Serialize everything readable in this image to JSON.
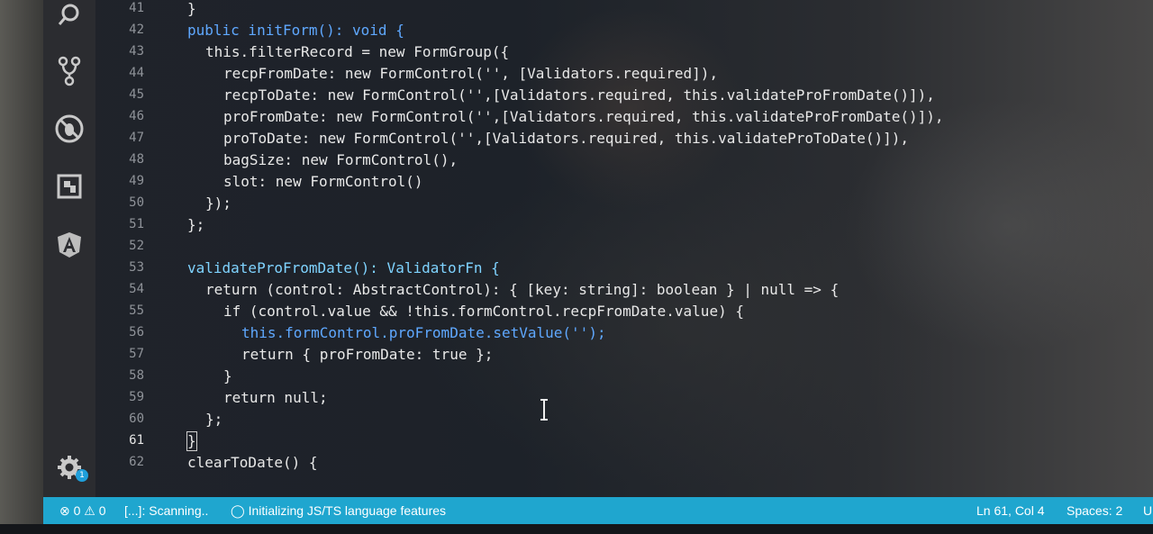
{
  "editor": {
    "lines": [
      {
        "n": "41",
        "text": "}"
      },
      {
        "n": "42",
        "text": "public initForm(): void {"
      },
      {
        "n": "43",
        "text": "this.filterRecord = new FormGroup({"
      },
      {
        "n": "44",
        "text": "recpFromDate: new FormControl('', [Validators.required]),"
      },
      {
        "n": "45",
        "text": "recpToDate: new FormControl('',[Validators.required, this.validateProFromDate()]),"
      },
      {
        "n": "46",
        "text": "proFromDate: new FormControl('',[Validators.required, this.validateProFromDate()]),"
      },
      {
        "n": "47",
        "text": "proToDate: new FormControl('',[Validators.required, this.validateProToDate()]),"
      },
      {
        "n": "48",
        "text": "bagSize: new FormControl(),"
      },
      {
        "n": "49",
        "text": "slot: new FormControl()"
      },
      {
        "n": "50",
        "text": "});"
      },
      {
        "n": "51",
        "text": "};"
      },
      {
        "n": "52",
        "text": ""
      },
      {
        "n": "53",
        "text": "validateProFromDate(): ValidatorFn {"
      },
      {
        "n": "54",
        "text": "return (control: AbstractControl): { [key: string]: boolean } | null => {"
      },
      {
        "n": "55",
        "text": "if (control.value && !this.formControl.recpFromDate.value) {"
      },
      {
        "n": "56",
        "text": "this.formControl.proFromDate.setValue('');"
      },
      {
        "n": "57",
        "text": "return { proFromDate: true };"
      },
      {
        "n": "58",
        "text": "}"
      },
      {
        "n": "59",
        "text": "return null;"
      },
      {
        "n": "60",
        "text": "};"
      },
      {
        "n": "61",
        "text": "}"
      },
      {
        "n": "62",
        "text": "clearToDate() {"
      }
    ],
    "active_line": "61"
  },
  "activity_bar": {
    "icons": [
      "search-icon",
      "source-control-icon",
      "debug-icon",
      "extensions-icon",
      "angular-icon",
      "settings-gear-icon"
    ],
    "settings_badge": "1"
  },
  "statusbar": {
    "problems": "⊗ 0 ⚠ 0",
    "scanning": "[...]: Scanning..",
    "language_status": "Initializing JS/TS language features",
    "cursor": "Ln 61, Col 4",
    "spaces": "Spaces: 2",
    "encoding_partial": "U"
  },
  "colors": {
    "statusbar": "#1fa6cf",
    "keyword": "#5fa8ff",
    "text": "#e8e8e8"
  }
}
